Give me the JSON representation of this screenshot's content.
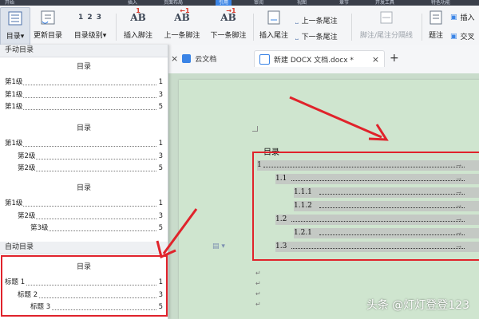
{
  "topbar": {
    "items": [
      "开始",
      "插入",
      "页面布局",
      "引用",
      "审阅",
      "视图",
      "章节",
      "开发工具",
      "特色功能"
    ]
  },
  "ribbon": {
    "toc_label": "目录",
    "update_toc_label": "更新目录",
    "toc_level_label": "目录级别",
    "toc_level_icon_text": "1 2 3",
    "ab_text": "AB",
    "insert_footnote_label": "插入脚注",
    "prev_footnote_label": "上一条脚注",
    "next_footnote_label": "下一条脚注",
    "insert_endnote_label": "插入尾注",
    "prev_endnote_label": "上一条尾注",
    "next_endnote_label": "下一条尾注",
    "separator_label": "脚注/尾注分隔线",
    "caption_label": "题注",
    "insert_label": "插入",
    "cross_ref_label": "交叉"
  },
  "toc_panel": {
    "manual_header": "手动目录",
    "auto_header": "自动目录",
    "templates": [
      {
        "title": "目录",
        "lines": [
          {
            "text": "第1级",
            "page": "1",
            "indent": 0
          },
          {
            "text": "第1级",
            "page": "3",
            "indent": 0
          },
          {
            "text": "第1级",
            "page": "5",
            "indent": 0
          }
        ]
      },
      {
        "title": "目录",
        "lines": [
          {
            "text": "第1级",
            "page": "1",
            "indent": 0
          },
          {
            "text": "第2级",
            "page": "3",
            "indent": 1
          },
          {
            "text": "第2级",
            "page": "5",
            "indent": 1
          }
        ]
      },
      {
        "title": "目录",
        "lines": [
          {
            "text": "第1级",
            "page": "1",
            "indent": 0
          },
          {
            "text": "第2级",
            "page": "3",
            "indent": 1
          },
          {
            "text": "第3级",
            "page": "5",
            "indent": 2
          }
        ]
      },
      {
        "title": "目录",
        "lines": [
          {
            "text": "标题 1",
            "page": "1",
            "indent": 0
          },
          {
            "text": "标题 2",
            "page": "3",
            "indent": 1
          },
          {
            "text": "标题 3",
            "page": "5",
            "indent": 2
          }
        ]
      }
    ]
  },
  "tabs": [
    {
      "label": "云文档",
      "active": false
    },
    {
      "label": "新建 DOCX 文档.docx *",
      "active": true
    }
  ],
  "tab_add": "+",
  "document": {
    "toc_title": "目录",
    "toc_entries": [
      {
        "num": "1",
        "level": 1
      },
      {
        "num": "1.1",
        "level": 2
      },
      {
        "num": "1.1.1",
        "level": 3
      },
      {
        "num": "1.1.2",
        "level": 3
      },
      {
        "num": "1.2",
        "level": 2
      },
      {
        "num": "1.2.1",
        "level": 3
      },
      {
        "num": "1.3",
        "level": 2
      }
    ],
    "paragraph_mark": "↵"
  },
  "watermark": "头条 @灯灯登登123",
  "colors": {
    "accent": "#3a84e6",
    "highlight_red": "#e0232b",
    "doc_bg": "#cfe5cf"
  }
}
